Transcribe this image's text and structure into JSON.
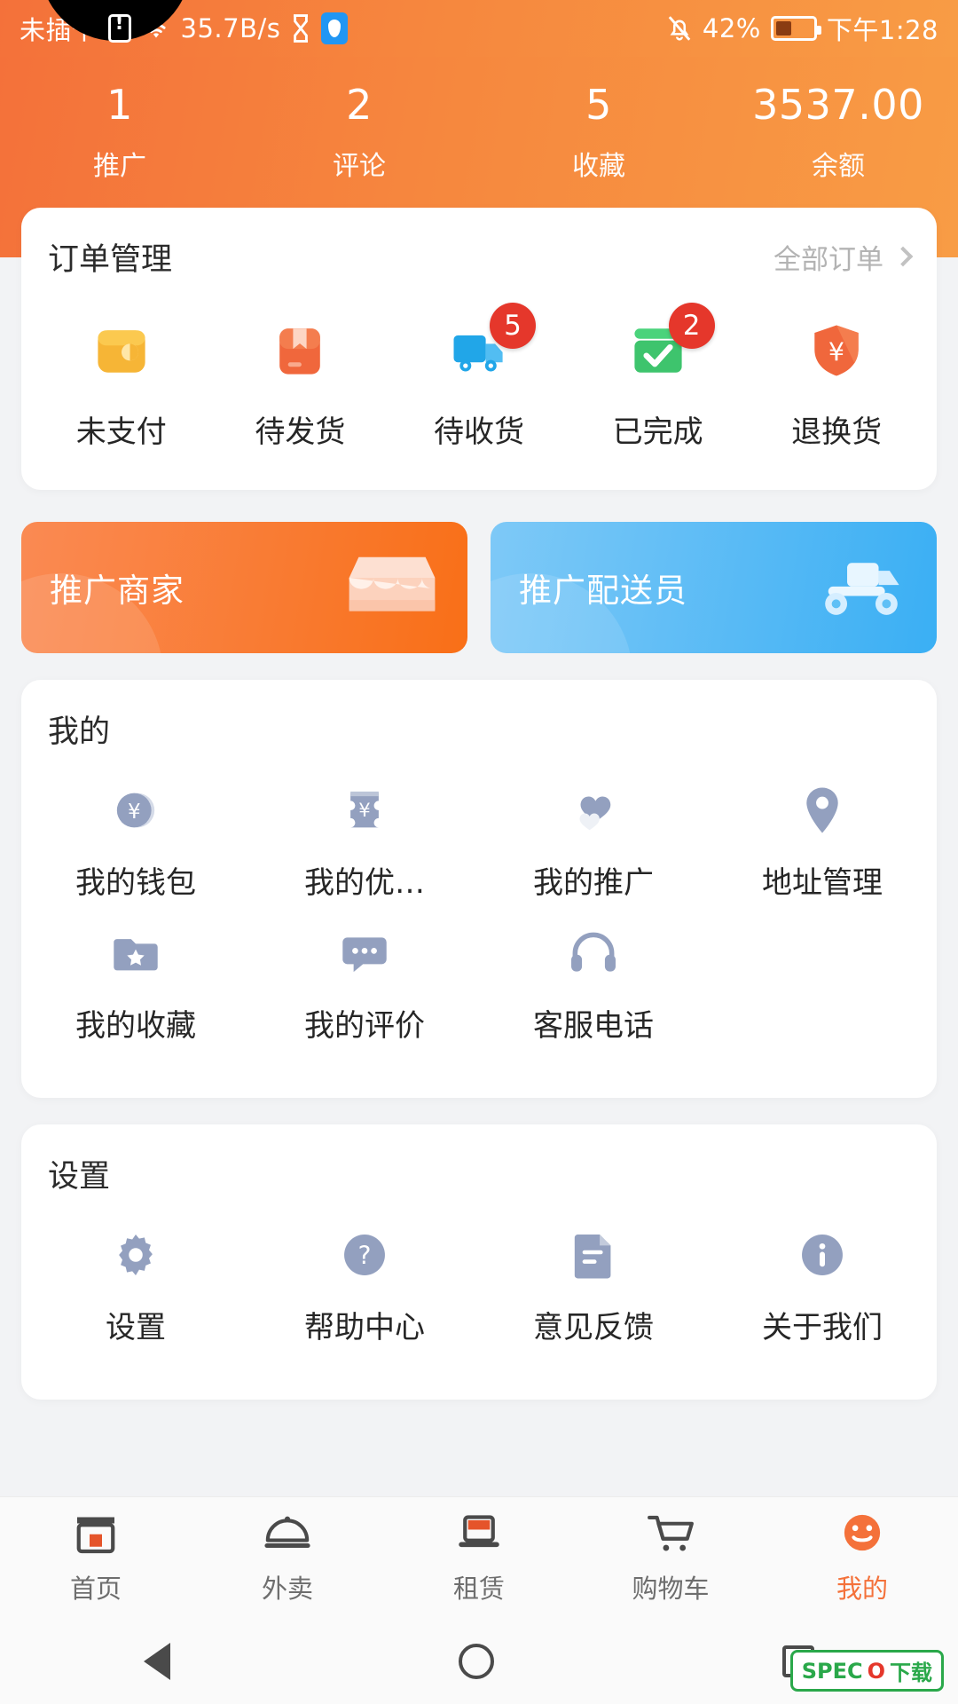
{
  "statusbar": {
    "carrier": "未插卡",
    "network_speed": "35.7B/s",
    "battery_percent": "42%",
    "time": "下午1:28",
    "icons": [
      "sim-card-icon",
      "wifi-icon",
      "hourglass-icon",
      "shield-icon",
      "bell-muted-icon",
      "battery-icon"
    ]
  },
  "header": {
    "stats": [
      {
        "value": "1",
        "label": "推广"
      },
      {
        "value": "2",
        "label": "评论"
      },
      {
        "value": "5",
        "label": "收藏"
      },
      {
        "value": "3537.00",
        "label": "余额"
      }
    ]
  },
  "orders": {
    "title": "订单管理",
    "more_label": "全部订单",
    "items": [
      {
        "label": "未支付",
        "icon": "wallet-icon",
        "badge": "",
        "color": "#f6b536"
      },
      {
        "label": "待发货",
        "icon": "package-icon",
        "badge": "",
        "color": "#f0673c"
      },
      {
        "label": "待收货",
        "icon": "truck-icon",
        "badge": "5",
        "color": "#21a6e8"
      },
      {
        "label": "已完成",
        "icon": "check-box-icon",
        "badge": "2",
        "color": "#3ec46d"
      },
      {
        "label": "退换货",
        "icon": "refund-shield-icon",
        "badge": "",
        "color": "#f0673c"
      }
    ]
  },
  "banners": [
    {
      "label": "推广商家",
      "icon": "shop-icon",
      "theme": "orange",
      "color": "#f97a30"
    },
    {
      "label": "推广配送员",
      "icon": "scooter-icon",
      "theme": "blue",
      "color": "#55b9f5"
    }
  ],
  "mine": {
    "title": "我的",
    "items": [
      {
        "label": "我的钱包",
        "icon": "coin-yen-icon"
      },
      {
        "label": "我的优…",
        "icon": "coupon-yen-icon"
      },
      {
        "label": "我的推广",
        "icon": "hearts-icon"
      },
      {
        "label": "地址管理",
        "icon": "location-pin-icon"
      },
      {
        "label": "我的收藏",
        "icon": "folder-star-icon"
      },
      {
        "label": "我的评价",
        "icon": "comment-dots-icon"
      },
      {
        "label": "客服电话",
        "icon": "headset-icon"
      }
    ]
  },
  "settings": {
    "title": "设置",
    "items": [
      {
        "label": "设置",
        "icon": "gear-icon"
      },
      {
        "label": "帮助中心",
        "icon": "question-circle-icon"
      },
      {
        "label": "意见反馈",
        "icon": "feedback-doc-icon"
      },
      {
        "label": "关于我们",
        "icon": "info-circle-icon"
      }
    ]
  },
  "tabbar": {
    "items": [
      {
        "label": "首页",
        "icon": "store-icon",
        "active": false
      },
      {
        "label": "外卖",
        "icon": "food-dome-icon",
        "active": false
      },
      {
        "label": "租赁",
        "icon": "laptop-icon",
        "active": false
      },
      {
        "label": "购物车",
        "icon": "cart-icon",
        "active": false
      },
      {
        "label": "我的",
        "icon": "smiley-icon",
        "active": true
      }
    ],
    "accent_color": "#f4713a"
  },
  "navbar": {
    "items": [
      "back-triangle-icon",
      "home-circle-icon",
      "recents-square-icon"
    ]
  },
  "watermark": {
    "text1": "SPEC",
    "text2": "O",
    "text3": "下载"
  }
}
